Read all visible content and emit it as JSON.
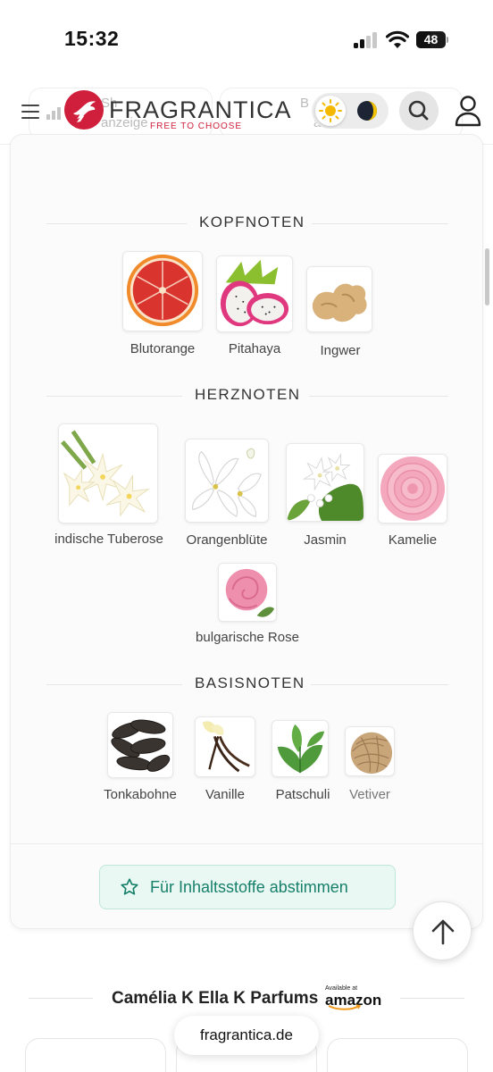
{
  "status_bar": {
    "time": "15:32",
    "battery": "48",
    "battery_level": 0.48
  },
  "header": {
    "ghost_tab_left": {
      "line1": "Sh",
      "line2": "anzeige"
    },
    "ghost_tab_right": {
      "line1": "B",
      "line2": "abstimmen"
    },
    "logo_text": "FRAGRANTICA",
    "logo_tagline": "FREE TO CHOOSE",
    "brand_color": "#d01f3c",
    "icons": [
      "menu-icon",
      "bar-chart-icon",
      "sun-icon",
      "moon-icon",
      "search-icon",
      "user-icon"
    ]
  },
  "notes": {
    "top": {
      "label": "KOPFNOTEN",
      "items": [
        {
          "name": "Blutorange",
          "icon": "blood-orange-image"
        },
        {
          "name": "Pitahaya",
          "icon": "dragonfruit-image"
        },
        {
          "name": "Ingwer",
          "icon": "ginger-image"
        }
      ]
    },
    "heart": {
      "label": "HERZNOTEN",
      "items": [
        {
          "name": "indische Tuberose",
          "icon": "tuberose-image"
        },
        {
          "name": "Orangenblüte",
          "icon": "orange-blossom-image"
        },
        {
          "name": "Jasmin",
          "icon": "jasmine-image"
        },
        {
          "name": "Kamelie",
          "icon": "camellia-image"
        },
        {
          "name": "bulgarische Rose",
          "icon": "rose-image"
        }
      ]
    },
    "base": {
      "label": "BASISNOTEN",
      "items": [
        {
          "name": "Tonkabohne",
          "icon": "tonka-bean-image"
        },
        {
          "name": "Vanille",
          "icon": "vanilla-image"
        },
        {
          "name": "Patschuli",
          "icon": "patchouli-image"
        },
        {
          "name": "Vetiver",
          "icon": "vetiver-image"
        }
      ]
    }
  },
  "vote_button": {
    "label": "Für Inhaltsstoffe abstimmen",
    "accent": "#17806a"
  },
  "shop": {
    "title": "Camélia K Ella K Parfums",
    "amazon_small": "Available at",
    "amazon_word": "amazon"
  },
  "url_bar": {
    "domain": "fragrantica.de"
  }
}
